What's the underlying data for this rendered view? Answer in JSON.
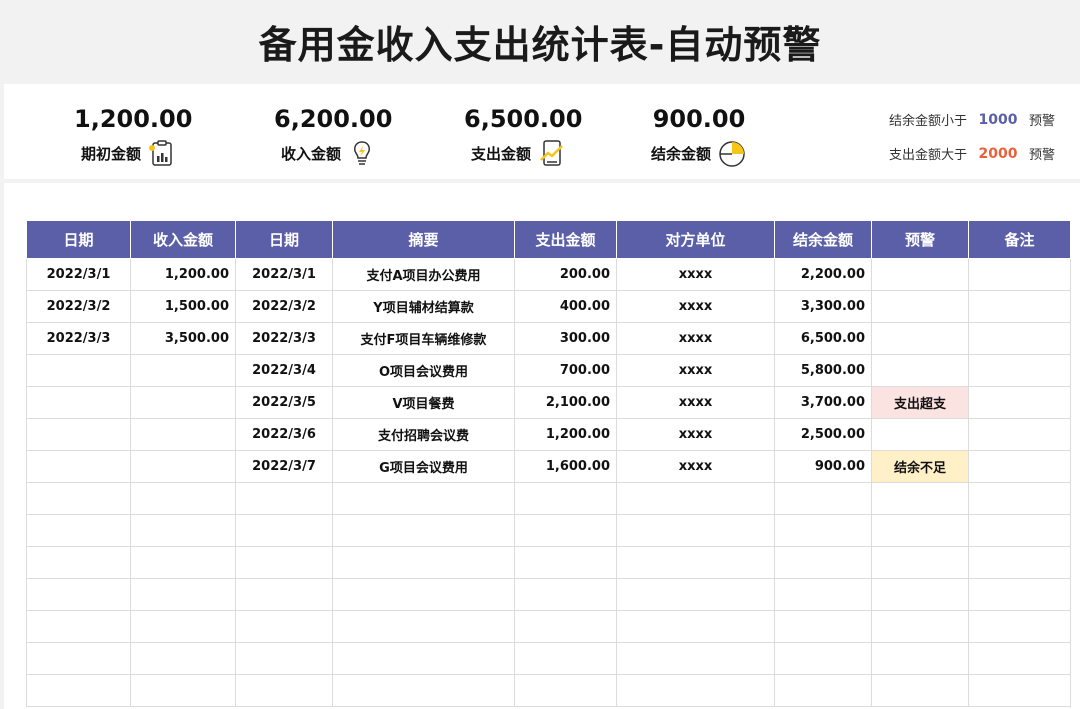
{
  "title": "备用金收入支出统计表-自动预警",
  "summary": {
    "opening": {
      "value": "1,200.00",
      "label": "期初金额",
      "icon": "clipboard-chart-icon"
    },
    "income": {
      "value": "6,200.00",
      "label": "收入金额",
      "icon": "lightbulb-icon"
    },
    "expense": {
      "value": "6,500.00",
      "label": "支出金额",
      "icon": "trend-chart-icon"
    },
    "balance": {
      "value": "900.00",
      "label": "结余金额",
      "icon": "pie-chart-icon"
    }
  },
  "warnings": {
    "balance_rule": {
      "prefix": "结余金额小于",
      "value": "1000",
      "suffix": "预警",
      "color": "#5b5fa8"
    },
    "expense_rule": {
      "prefix": "支出金额大于",
      "value": "2000",
      "suffix": "预警",
      "color": "#e8613c"
    }
  },
  "table": {
    "headers": [
      "日期",
      "收入金额",
      "日期",
      "摘要",
      "支出金额",
      "对方单位",
      "结余金额",
      "预警",
      "备注"
    ],
    "rows": [
      [
        "2022/3/1",
        "1,200.00",
        "2022/3/1",
        "支付A项目办公费用",
        "200.00",
        "xxxx",
        "2,200.00",
        "",
        ""
      ],
      [
        "2022/3/2",
        "1,500.00",
        "2022/3/2",
        "Y项目辅材结算款",
        "400.00",
        "xxxx",
        "3,300.00",
        "",
        ""
      ],
      [
        "2022/3/3",
        "3,500.00",
        "2022/3/3",
        "支付F项目车辆维修款",
        "300.00",
        "xxxx",
        "6,500.00",
        "",
        ""
      ],
      [
        "",
        "",
        "2022/3/4",
        "O项目会议费用",
        "700.00",
        "xxxx",
        "5,800.00",
        "",
        ""
      ],
      [
        "",
        "",
        "2022/3/5",
        "V项目餐费",
        "2,100.00",
        "xxxx",
        "3,700.00",
        "支出超支",
        ""
      ],
      [
        "",
        "",
        "2022/3/6",
        "支付招聘会议费",
        "1,200.00",
        "xxxx",
        "2,500.00",
        "",
        ""
      ],
      [
        "",
        "",
        "2022/3/7",
        "G项目会议费用",
        "1,600.00",
        "xxxx",
        "900.00",
        "结余不足",
        ""
      ],
      [
        "",
        "",
        "",
        "",
        "",
        "",
        "",
        "",
        ""
      ],
      [
        "",
        "",
        "",
        "",
        "",
        "",
        "",
        "",
        ""
      ],
      [
        "",
        "",
        "",
        "",
        "",
        "",
        "",
        "",
        ""
      ],
      [
        "",
        "",
        "",
        "",
        "",
        "",
        "",
        "",
        ""
      ],
      [
        "",
        "",
        "",
        "",
        "",
        "",
        "",
        "",
        ""
      ],
      [
        "",
        "",
        "",
        "",
        "",
        "",
        "",
        "",
        ""
      ],
      [
        "",
        "",
        "",
        "",
        "",
        "",
        "",
        "",
        ""
      ]
    ]
  }
}
